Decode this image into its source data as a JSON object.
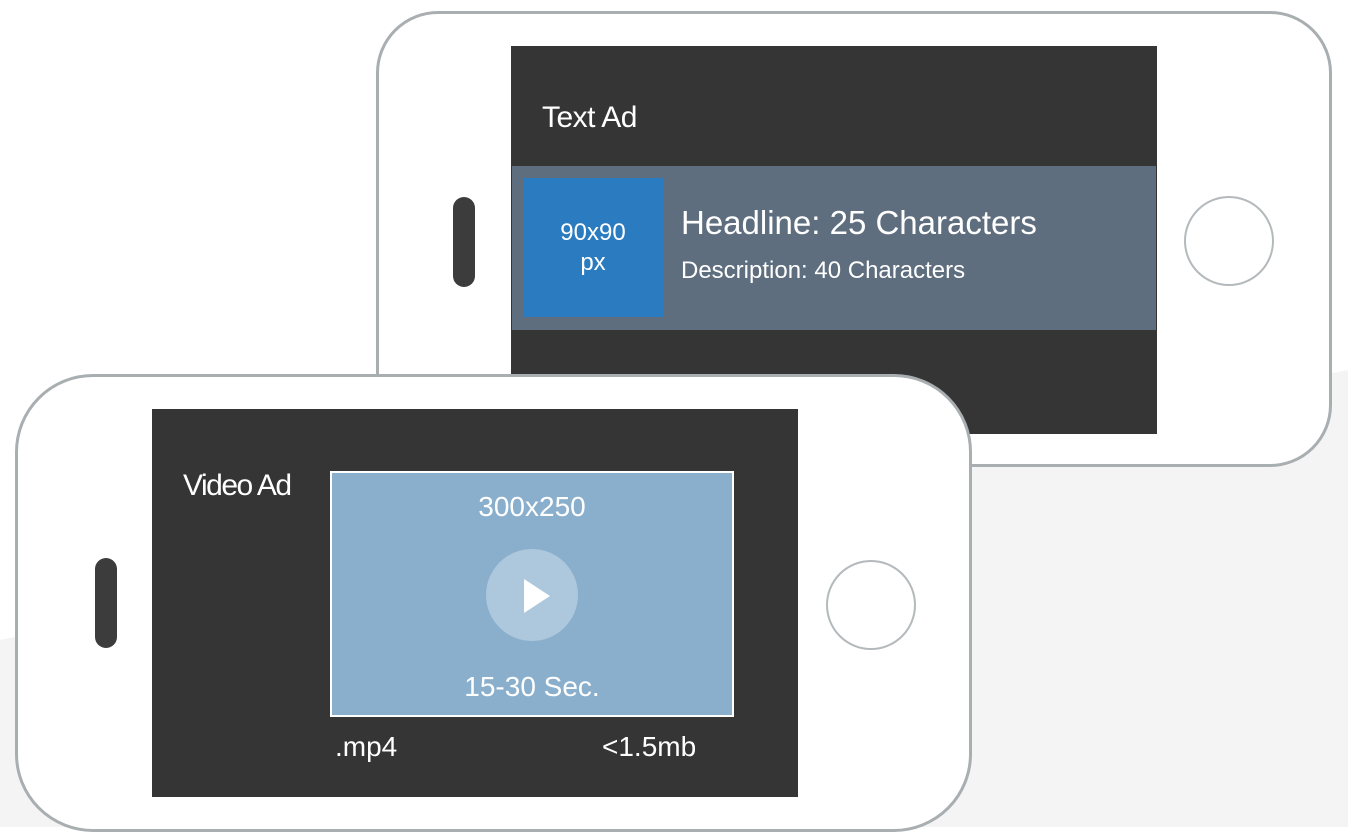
{
  "text_ad": {
    "title": "Text Ad",
    "thumbnail_line1": "90x90",
    "thumbnail_line2": "px",
    "headline": "Headline: 25 Characters",
    "description": "Description: 40 Characters"
  },
  "video_ad": {
    "title": "Video Ad",
    "size": "300x250",
    "duration": "15-30 Sec.",
    "format": ".mp4",
    "file_size": "<1.5mb",
    "play_icon": "play-icon"
  },
  "colors": {
    "screen": "#353535",
    "text_ad_band": "#5e6e7e",
    "thumbnail": "#2a7bbf",
    "video_box": "#8aafcd",
    "phone_frame": "#a9aeb1"
  }
}
